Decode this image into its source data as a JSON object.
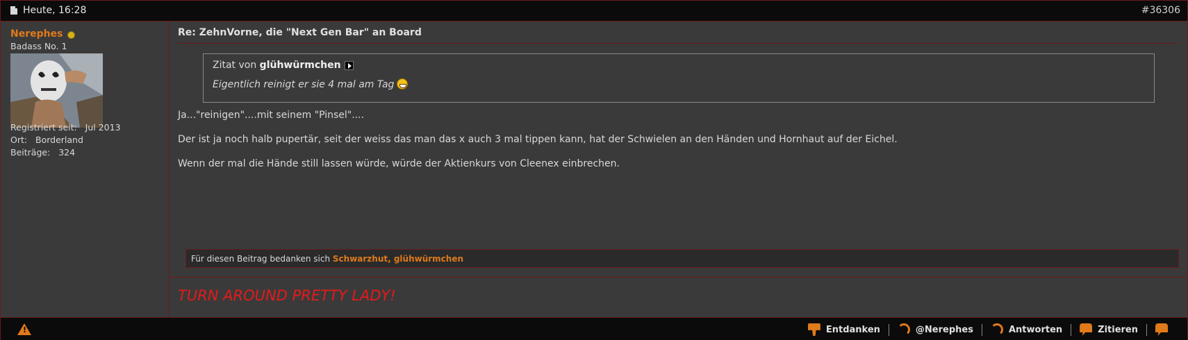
{
  "header": {
    "date": "Heute, 16:28",
    "post_number": "#36306"
  },
  "user": {
    "name": "Nerephes",
    "title": "Badass No. 1",
    "info": [
      {
        "label": "Registriert seit:",
        "value": "Jul 2013"
      },
      {
        "label": "Ort:",
        "value": "Borderland"
      },
      {
        "label": "Beiträge:",
        "value": "324"
      }
    ]
  },
  "post": {
    "title": "Re: ZehnVorne, die \"Next Gen Bar\" an Board",
    "quote": {
      "prefix": "Zitat von",
      "author": "glühwürmchen",
      "text": "Eigentlich reinigt er sie 4 mal am Tag"
    },
    "paragraphs": [
      "Ja...\"reinigen\"....mit seinem \"Pinsel\"....",
      "Der ist ja noch halb pupertär, seit der weiss das man das x auch 3 mal tippen kann, hat der Schwielen an den Händen und Hornhaut auf der Eichel.",
      "Wenn der mal die Hände still lassen würde, würde der Aktienkurs von Cleenex einbrechen."
    ],
    "thanks_label": "Für diesen Beitrag bedanken sich",
    "thanks_users": "Schwarzhut, glühwürmchen",
    "signature": "TURN AROUND PRETTY LADY!"
  },
  "footer": {
    "actions": [
      {
        "icon": "thumbs-down-icon",
        "label": "Entdanken"
      },
      {
        "icon": "reply-arrow-icon",
        "label": "@Nerephes"
      },
      {
        "icon": "reply-arrow-icon",
        "label": "Antworten"
      },
      {
        "icon": "speech-bubble-icon",
        "label": "Zitieren"
      },
      {
        "icon": "speech-bubble-plus-icon",
        "label": ""
      }
    ]
  },
  "colors": {
    "accent": "#e07a1a",
    "border": "#6b1a1a",
    "signature": "#e61a1a",
    "background": "#3a3a3a"
  }
}
